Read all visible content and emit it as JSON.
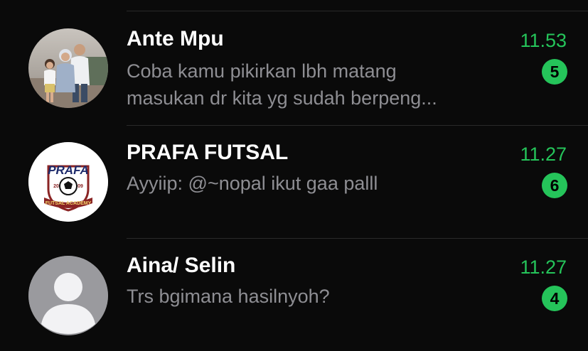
{
  "chats": [
    {
      "name": "Ante Mpu",
      "preview_line1": "Coba kamu pikirkan lbh matang",
      "preview_line2": "masukan dr kita yg sudah berpeng...",
      "time": "11.53",
      "unread": "5",
      "avatar_icon": "family-photo-avatar"
    },
    {
      "name": "PRAFA FUTSAL",
      "preview_line1": "Ayyiip: @~nopal ikut gaa palll",
      "time": "11.27",
      "unread": "6",
      "avatar_icon": "futsal-academy-logo",
      "logo": {
        "title": "PRAFA",
        "year_left": "20",
        "year_right": "09",
        "banner": "FUTSAL ACADEMY"
      }
    },
    {
      "name": "Aina/ Selin",
      "preview_line1": "Trs bgimana hasilnyoh?",
      "time": "11.27",
      "unread": "4",
      "avatar_icon": "default-person-avatar"
    }
  ],
  "colors": {
    "background": "#0a0a0a",
    "accent_green": "#25c45a",
    "preview_gray": "#8e8e93",
    "divider": "#2a2a2a"
  }
}
